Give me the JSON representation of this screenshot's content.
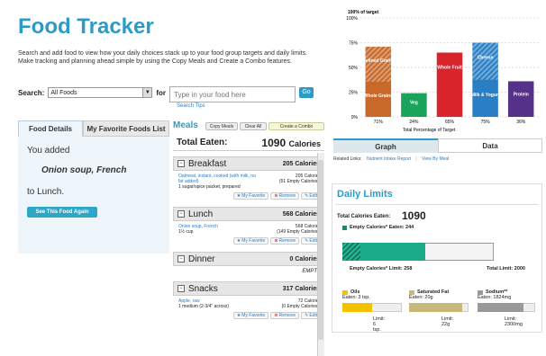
{
  "app": {
    "title": "Food Tracker",
    "intro": "Search and add food to view how your daily choices stack up to your food group targets and daily limits. Make tracking and planning ahead simple by using the Copy Meals and Create a Combo features."
  },
  "search": {
    "label": "Search:",
    "select_value": "All Foods",
    "for_label": "for",
    "placeholder": "Type in your food here",
    "go_label": "Go",
    "tips_label": "Search Tips"
  },
  "left_tabs": {
    "food_details": "Food Details",
    "favorites": "My Favorite Foods List"
  },
  "details": {
    "you_added": "You added",
    "food_name": "Onion soup, French",
    "to_meal": "to Lunch.",
    "see_again": "See This Food Again"
  },
  "meals": {
    "title": "Meals",
    "copy_meals": "Copy Meals",
    "clear_all": "Clear All",
    "create_combo": "Create a Combo",
    "total_eaten_label": "Total Eaten:",
    "total_eaten_value": "1090",
    "total_eaten_unit": "Calories",
    "action_favorite": "My Favorite",
    "action_remove": "Remove",
    "action_edit": "Edit",
    "sections": [
      {
        "name": "Breakfast",
        "calories": "205 Calories",
        "item_name": "Oatmeal, instant, cooked (with milk, no fat added)",
        "item_portion": "1 sugar/spice packet, prepared",
        "item_cal": "205 Calories",
        "item_empty": "(51 Empty Calories*)"
      },
      {
        "name": "Lunch",
        "calories": "568 Calories",
        "item_name": "Onion soup, French",
        "item_portion": "1½ cup",
        "item_cal": "568 Calories",
        "item_empty": "(149 Empty Calories*)"
      },
      {
        "name": "Dinner",
        "calories": "0 Calories",
        "empty_text": "EMPTY"
      },
      {
        "name": "Snacks",
        "calories": "317 Calories",
        "item_name": "Apple, raw",
        "item_portion": "1 medium (2-3/4\" across)",
        "item_cal": "72 Calories",
        "item_empty": "(0 Empty Calories*)"
      }
    ]
  },
  "chart_data": {
    "type": "bar",
    "categories": [
      "Refined Grains / Whole Grains",
      "Veg",
      "Whole Fruit",
      "Cheese / Milk & Yogurt",
      "Protein"
    ],
    "series": [
      {
        "values": [
          71,
          24,
          65,
          75,
          36
        ]
      }
    ],
    "segment_labels": [
      [
        "Refined Grains",
        "Whole Grains"
      ],
      [
        "Veg"
      ],
      [
        "Whole Fruit"
      ],
      [
        "Cheese",
        "Milk & Yogurt"
      ],
      [
        "Protein"
      ]
    ],
    "tick_labels": [
      "71%",
      "24%",
      "65%",
      "75%",
      "36%"
    ],
    "y_ticks": [
      "0%",
      "25%",
      "50%",
      "75%",
      "100%"
    ],
    "ylabel": "100% of target",
    "xlabel": "Total Percentage of Target",
    "ylim": [
      0,
      100
    ],
    "colors": [
      "#c8692a",
      "#1aa35b",
      "#d9242b",
      "#2a7fc4",
      "#563189"
    ],
    "grid": true
  },
  "chart_tabs": {
    "graph": "Graph",
    "data": "Data"
  },
  "related": {
    "label": "Related Links:",
    "link1": "Nutrient Intake Report",
    "link2": "View By Meal"
  },
  "daily_limits": {
    "title": "Daily Limits",
    "total_label": "Total Calories Eaten:",
    "total_value": "1090",
    "empty_eaten": "Empty Calories* Eaten: 244",
    "empty_limit": "Empty Calories* Limit: 258",
    "total_limit": "Total Limit: 2000",
    "empty_eaten_value": 244,
    "empty_limit_value": 258,
    "total_eaten_value": 1090,
    "total_limit_value": 2000,
    "oils": {
      "label": "Oils",
      "eaten": "Eaten: 3 tsp.",
      "limit": "Limit: 6 tsp.",
      "color": "#f2c200",
      "fraction": 0.5
    },
    "sat_fat": {
      "label": "Saturated Fat",
      "eaten": "Eaten: 20g",
      "limit": "Limit: 22g",
      "color": "#c8b87a",
      "fraction": 0.9
    },
    "sodium": {
      "label": "Sodium**",
      "eaten": "Eaten: 1824mg",
      "limit": "Limit: 2300mg",
      "color": "#999999",
      "fraction": 0.79
    }
  }
}
